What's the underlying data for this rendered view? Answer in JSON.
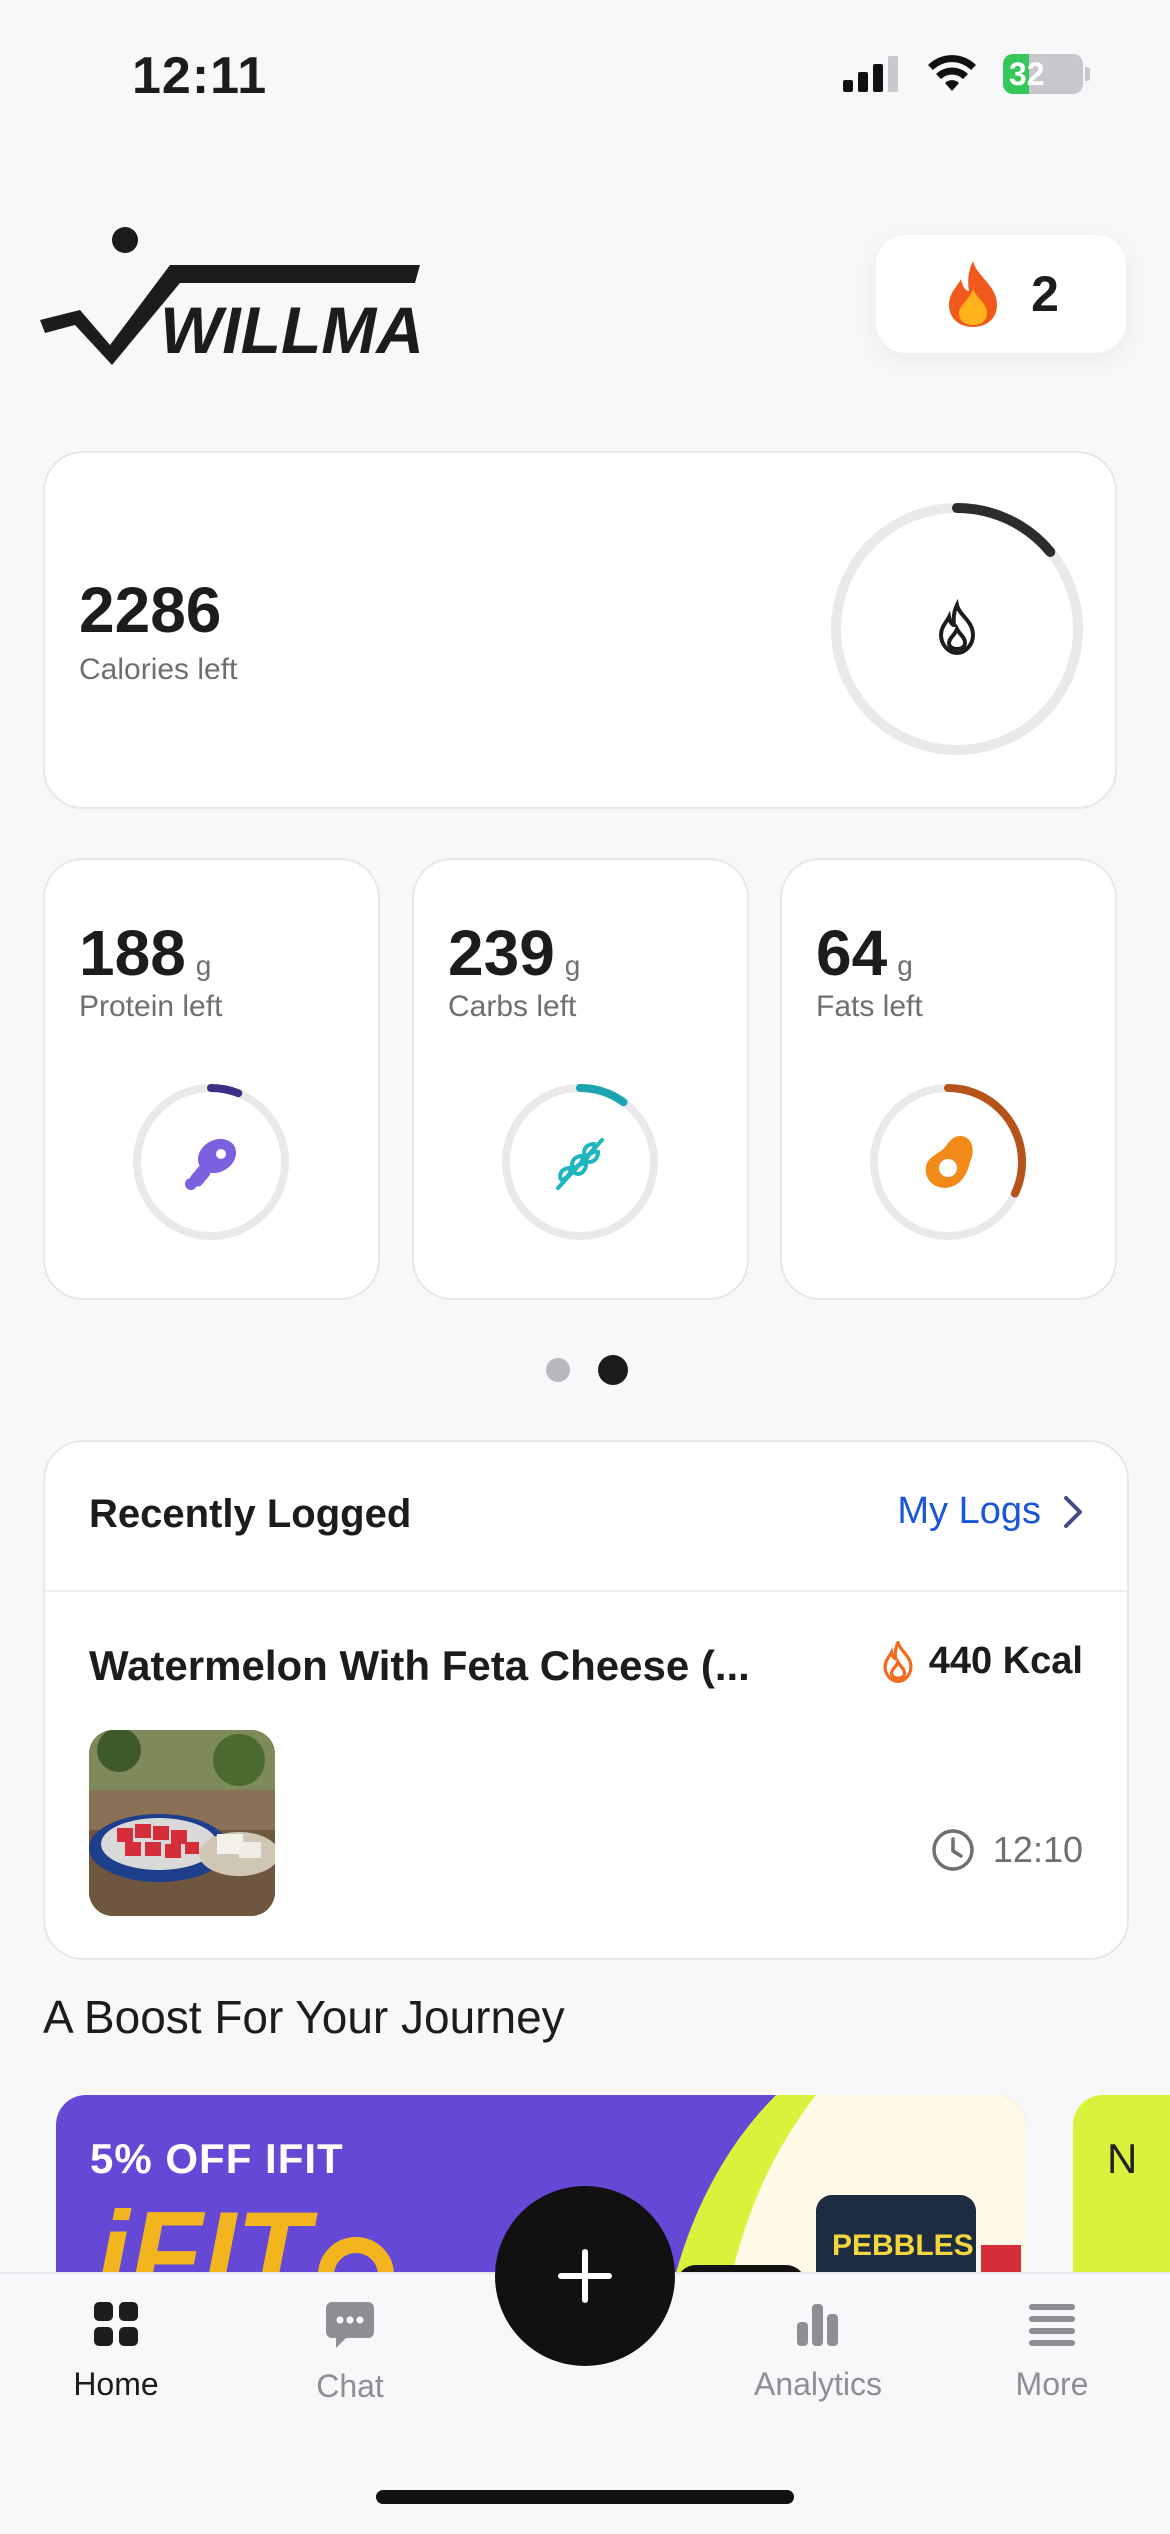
{
  "status_bar": {
    "time": "12:11",
    "battery": "32"
  },
  "header": {
    "brand": "WILLMA",
    "streak_count": "2"
  },
  "calories": {
    "value": "2286",
    "label": "Calories left",
    "progress": 0.14
  },
  "macros": [
    {
      "value": "188",
      "unit": "g",
      "label": "Protein left",
      "icon": "drumstick-icon",
      "color": "#3d2f86",
      "icon_color": "#7b61e0",
      "progress": 0.06
    },
    {
      "value": "239",
      "unit": "g",
      "label": "Carbs left",
      "icon": "wheat-icon",
      "color": "#1aa5b0",
      "icon_color": "#1fb5bf",
      "progress": 0.1
    },
    {
      "value": "64",
      "unit": "g",
      "label": "Fats left",
      "icon": "avocado-icon",
      "color": "#b5531a",
      "icon_color": "#f28a1a",
      "progress": 0.32
    }
  ],
  "pager": {
    "count": 2,
    "active": 1
  },
  "recent": {
    "title": "Recently Logged",
    "link": "My Logs",
    "items": [
      {
        "name": "Watermelon With Feta Cheese (...",
        "kcal": "440 Kcal",
        "time": "12:10"
      }
    ]
  },
  "boost": {
    "title": "A Boost For Your Journey",
    "promo_1": "5% OFF IFIT",
    "promo_2": "N"
  },
  "tabs": [
    {
      "label": "Home",
      "icon": "grid-icon",
      "active": true
    },
    {
      "label": "Chat",
      "icon": "chat-icon",
      "active": false
    },
    {
      "label": "Analytics",
      "icon": "bar-chart-icon",
      "active": false
    },
    {
      "label": "More",
      "icon": "menu-icon",
      "active": false
    }
  ]
}
